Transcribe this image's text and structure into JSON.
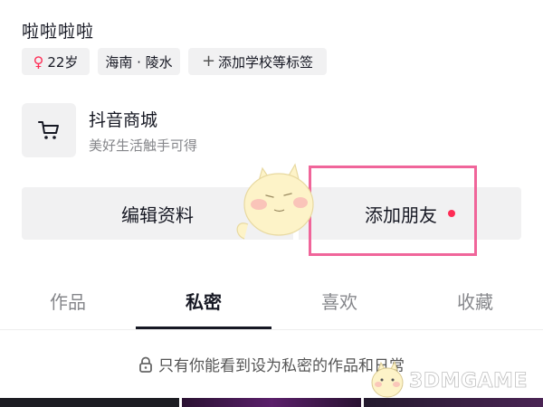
{
  "profile": {
    "username": "啦啦啦啦",
    "tags": {
      "age": "22岁",
      "location": "海南 · 陵水",
      "add_tag": "添加学校等标签"
    }
  },
  "mall": {
    "title": "抖音商城",
    "subtitle": "美好生活触手可得",
    "icon": "cart-icon"
  },
  "actions": {
    "edit_profile": "编辑资料",
    "add_friend": "添加朋友",
    "notification_color": "#fe2c55"
  },
  "tabs": [
    {
      "label": "作品",
      "active": false
    },
    {
      "label": "私密",
      "active": true
    },
    {
      "label": "喜欢",
      "active": false
    },
    {
      "label": "收藏",
      "active": false
    }
  ],
  "private_note": "只有你能看到设为私密的作品和日常",
  "highlight_color": "#f0659a",
  "watermark": "3DMGAME"
}
